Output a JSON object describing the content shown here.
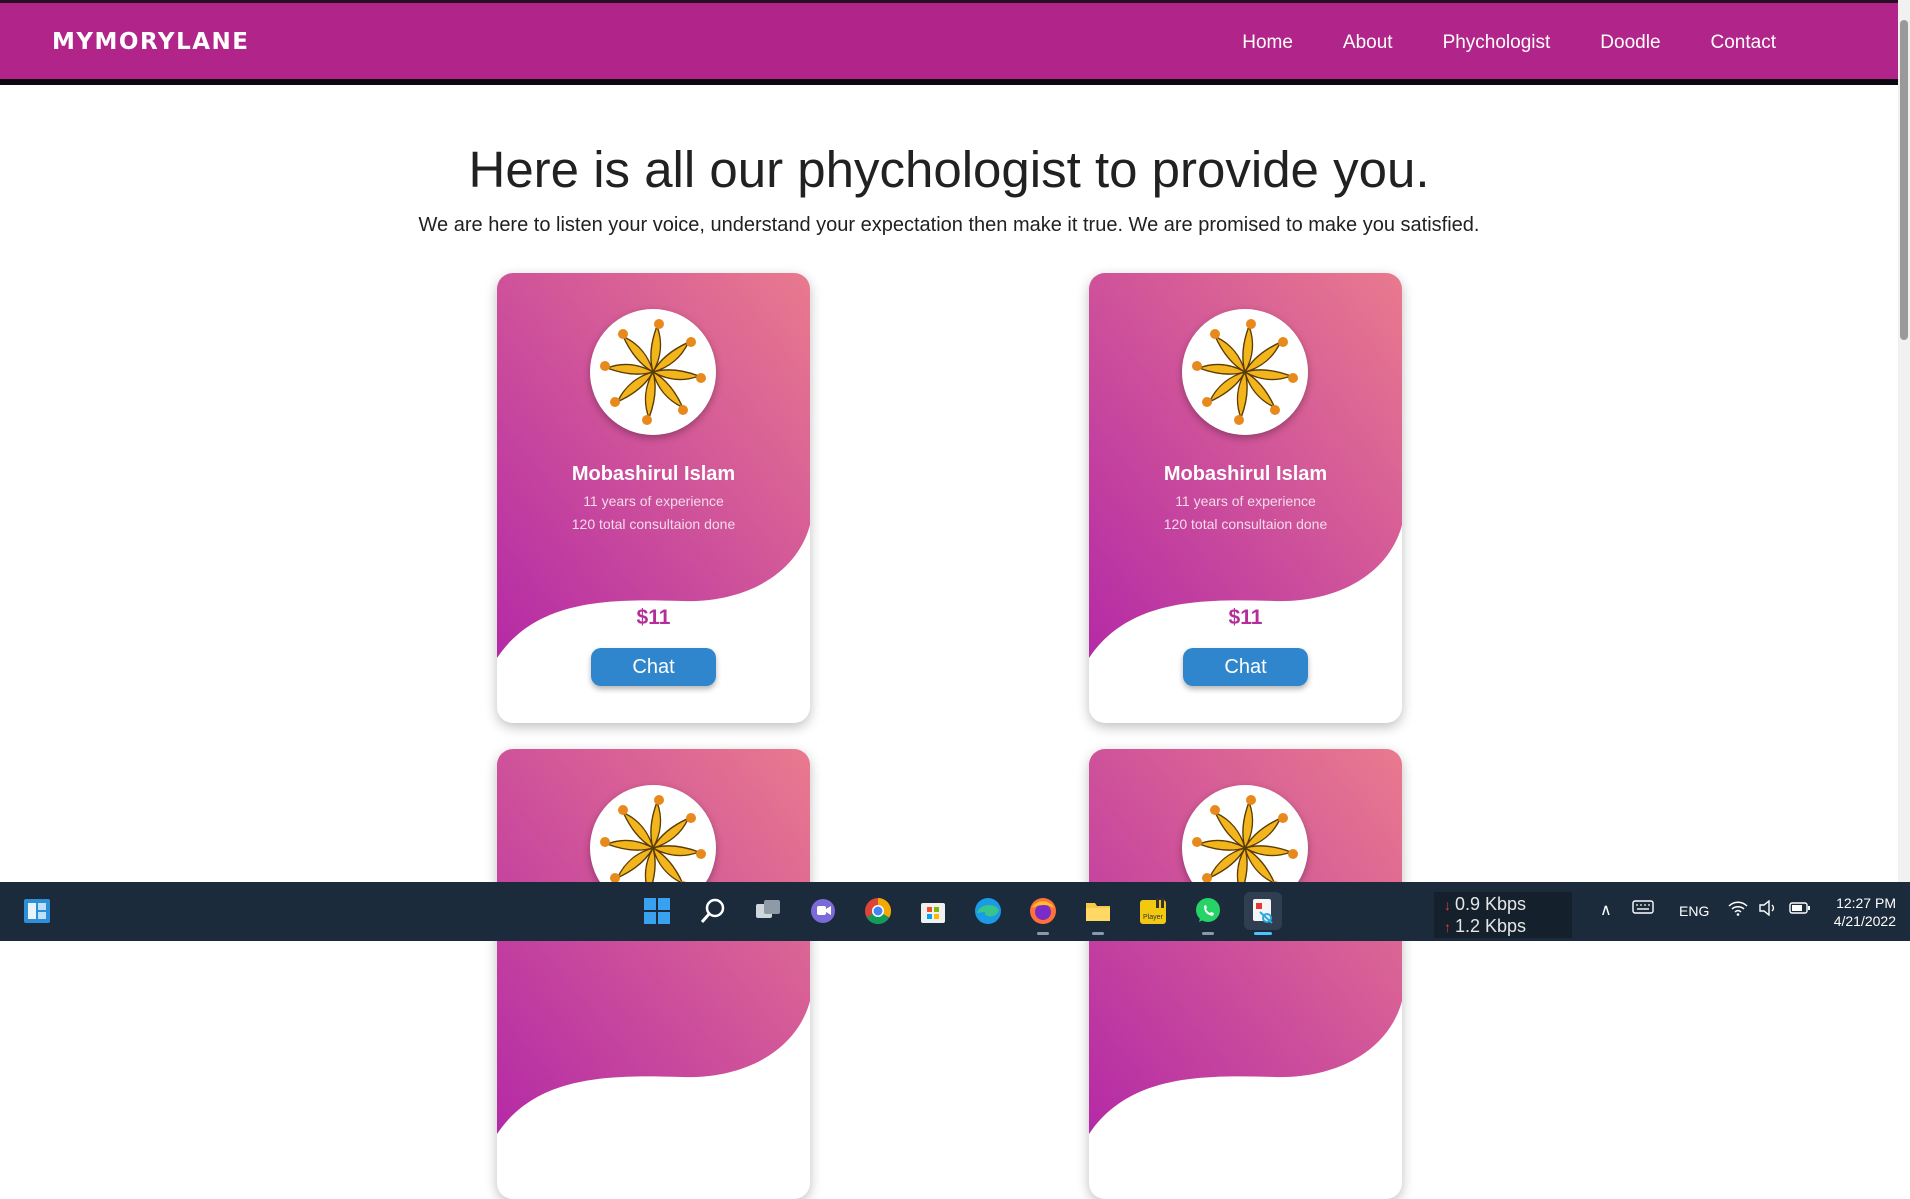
{
  "navbar": {
    "brand": "MYMORYLANE",
    "links": [
      "Home",
      "About",
      "Phychologist",
      "Doodle",
      "Contact"
    ]
  },
  "hero": {
    "title": "Here is all our phychologist to provide you.",
    "subtitle": "We are here to listen your voice, understand your expectation then make it true. We are promised to make you satisfied."
  },
  "cards": [
    {
      "name": "Mobashirul Islam",
      "experience": "11 years of experience",
      "consultations": "120 total consultaion done",
      "price": "$11",
      "button": "Chat"
    },
    {
      "name": "Mobashirul Islam",
      "experience": "11 years of experience",
      "consultations": "120 total consultaion done",
      "price": "$11",
      "button": "Chat"
    },
    {
      "name": "",
      "experience": "",
      "consultations": "",
      "price": "",
      "button": ""
    },
    {
      "name": "",
      "experience": "",
      "consultations": "",
      "price": "",
      "button": ""
    }
  ],
  "taskbar": {
    "apps": [
      "widgets-icon",
      "start-icon",
      "search-icon",
      "task-view-icon",
      "teams-chat-icon",
      "chrome-icon",
      "microsoft-store-icon",
      "edge-icon",
      "firefox-icon",
      "file-explorer-icon",
      "player-icon",
      "whatsapp-icon",
      "snipping-tool-icon"
    ],
    "player_label": "Player",
    "network_down": "0.9 Kbps",
    "network_up": "1.2 Kbps",
    "language": "ENG",
    "time": "12:27 PM",
    "date": "4/21/2022"
  },
  "colors": {
    "nav_bg": "#b1258a",
    "card_gradient_top": "#e97a8e",
    "card_gradient_bottom": "#b42aa6",
    "price": "#b52d9b",
    "chat_button": "#2f86cc",
    "taskbar_bg": "#1c2b3c"
  }
}
